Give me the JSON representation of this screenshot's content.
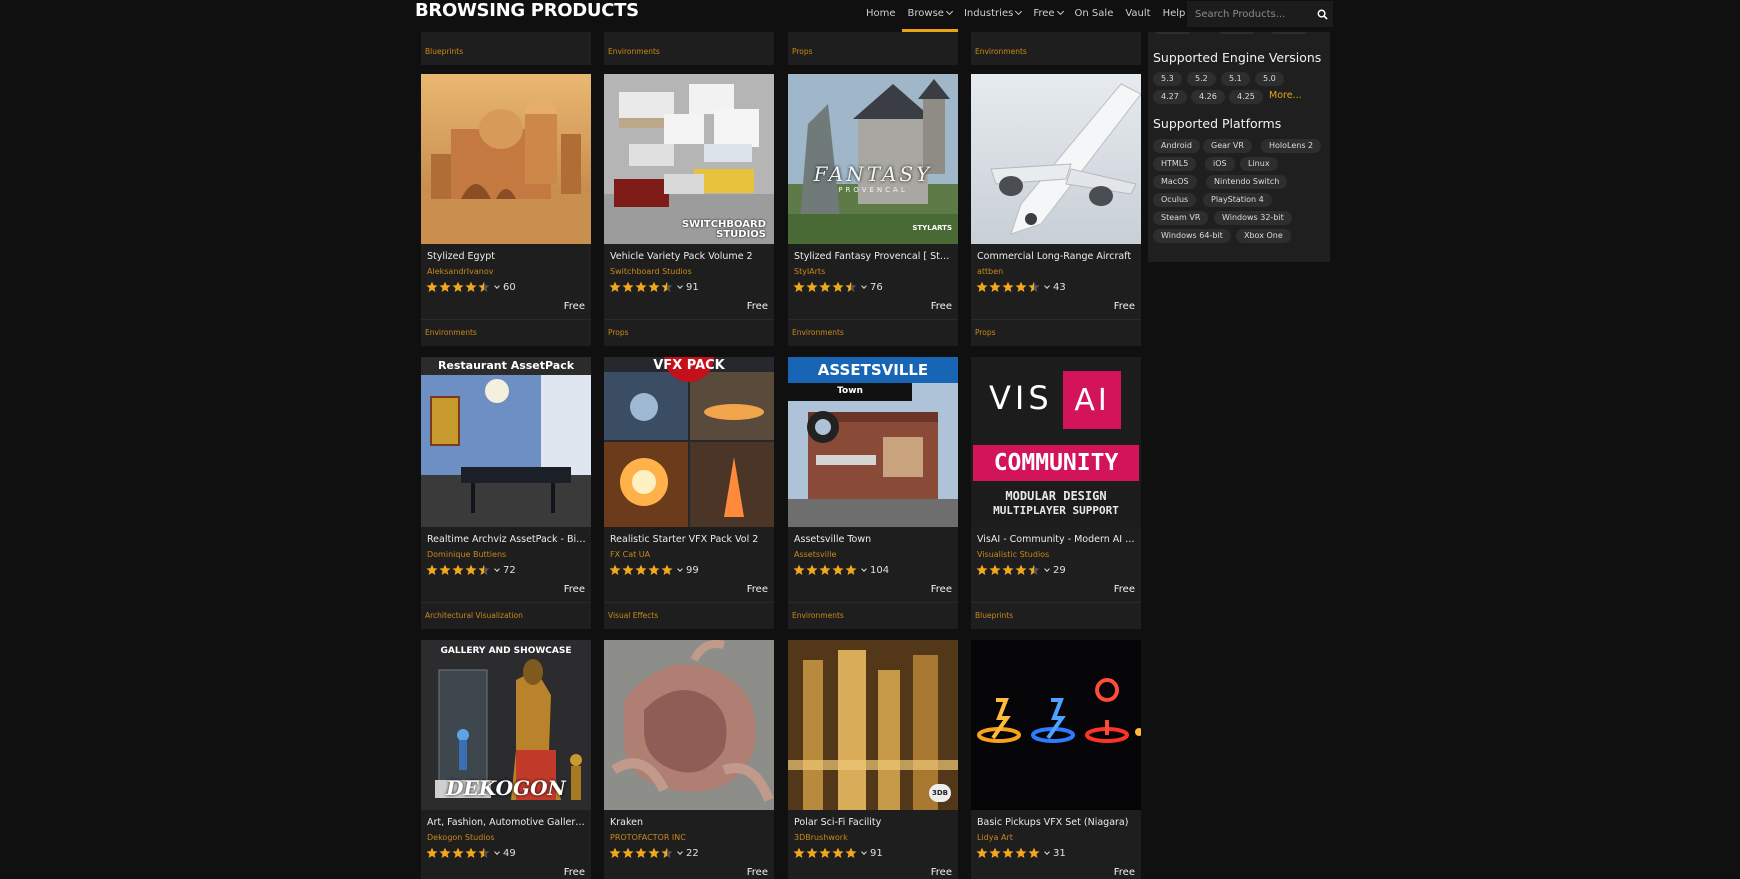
{
  "header": {
    "title": "BROWSING PRODUCTS",
    "nav": [
      {
        "label": "Home",
        "dropdown": false
      },
      {
        "label": "Browse",
        "dropdown": true,
        "active": true
      },
      {
        "label": "Industries",
        "dropdown": true
      },
      {
        "label": "Free",
        "dropdown": true
      },
      {
        "label": "On Sale",
        "dropdown": false
      },
      {
        "label": "Vault",
        "dropdown": false
      },
      {
        "label": "Help",
        "dropdown": false
      }
    ],
    "search_placeholder": "Search Products...",
    "accent": "#e8a317"
  },
  "top_strip_categories": [
    "Blueprints",
    "Environments",
    "Props",
    "Environments"
  ],
  "products": [
    {
      "title": "Stylized Egypt",
      "seller": "AleksandrIvanov",
      "stars": 4.5,
      "reviews": "60",
      "price": "Free",
      "category": "Environments"
    },
    {
      "title": "Vehicle Variety Pack Volume 2",
      "seller": "Switchboard Studios",
      "stars": 4.5,
      "reviews": "91",
      "price": "Free",
      "category": "Props"
    },
    {
      "title": "Stylized Fantasy Provencal [ Stylized Fantasy Provencal ]",
      "seller": "StylArts",
      "stars": 4.5,
      "reviews": "76",
      "price": "Free",
      "category": "Environments"
    },
    {
      "title": "Commercial Long-Range Aircraft",
      "seller": "attben",
      "stars": 4.5,
      "reviews": "43",
      "price": "Free",
      "category": "Props"
    },
    {
      "title": "Realtime Archviz AssetPack - Bistro",
      "seller": "Dominique Buttiens",
      "stars": 4.5,
      "reviews": "72",
      "price": "Free",
      "category": "Architectural Visualization"
    },
    {
      "title": "Realistic Starter VFX Pack Vol 2",
      "seller": "FX Cat UA",
      "stars": 5,
      "reviews": "99",
      "price": "Free",
      "category": "Visual Effects"
    },
    {
      "title": "Assetsville Town",
      "seller": "Assetsville",
      "stars": 5,
      "reviews": "104",
      "price": "Free",
      "category": "Environments"
    },
    {
      "title": "VisAI - Community - Modern AI Framework",
      "seller": "Visualistic Studios",
      "stars": 4.5,
      "reviews": "29",
      "price": "Free",
      "category": "Blueprints"
    },
    {
      "title": "Art, Fashion, Automotive Galleries and Showcase",
      "seller": "Dekogon Studios",
      "stars": 4.5,
      "reviews": "49",
      "price": "Free",
      "category": ""
    },
    {
      "title": "Kraken",
      "seller": "PROTOFACTOR INC",
      "stars": 4.5,
      "reviews": "22",
      "price": "Free",
      "category": ""
    },
    {
      "title": "Polar Sci-Fi Facility",
      "seller": "3DBrushwork",
      "stars": 5,
      "reviews": "91",
      "price": "Free",
      "category": ""
    },
    {
      "title": "Basic Pickups VFX Set (Niagara)",
      "seller": "Lidya Art",
      "stars": 5,
      "reviews": "31",
      "price": "Free",
      "category": ""
    }
  ],
  "thumb_text": {
    "restaurant": "Restaurant AssetPack",
    "vfx": "VFX PACK",
    "assetsville": "ASSETSVILLE",
    "town": "Town",
    "visai_vis": "VIS",
    "visai_ai": "AI",
    "community": "COMMUNITY",
    "modular": "MODULAR DESIGN",
    "multiplayer": "MULTIPLAYER SUPPORT",
    "gallery": "GALLERY AND SHOWCASE",
    "dekogon": "DEKOGON",
    "switchboard1": "SWITCHBOARD",
    "switchboard2": "STUDIOS",
    "fantasy": "FANTASY",
    "provencal": "PROVENCAL",
    "styl": "STYLARTS",
    "threedb": "3DB"
  },
  "sidebar": {
    "engine_heading": "Supported Engine Versions",
    "engine_versions": [
      "5.3",
      "5.2",
      "5.1",
      "5.0",
      "4.27",
      "4.26",
      "4.25"
    ],
    "more_label": "More...",
    "platforms_heading": "Supported Platforms",
    "platforms": [
      "Android",
      "Gear VR",
      "HoloLens 2",
      "HTML5",
      "iOS",
      "Linux",
      "MacOS",
      "Nintendo Switch",
      "Oculus",
      "PlayStation 4",
      "Steam VR",
      "Windows 32-bit",
      "Windows 64-bit",
      "Xbox One"
    ]
  },
  "colors": {
    "background": "#101010",
    "card": "#1e1e1e",
    "seller": "#c9881a",
    "star": "#f0a81c"
  }
}
